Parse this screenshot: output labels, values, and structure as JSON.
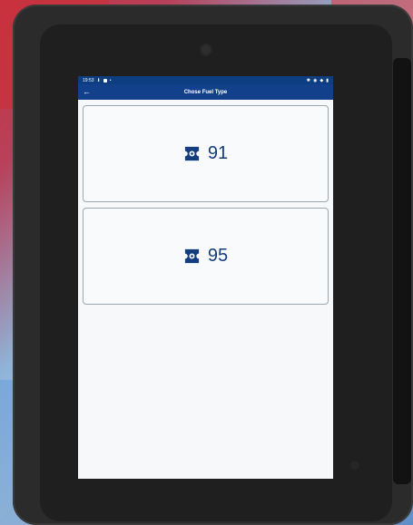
{
  "status_bar": {
    "time": "19:53"
  },
  "app_bar": {
    "title": "Chose Fuel Type"
  },
  "fuel_options": [
    {
      "label": "91",
      "icon": "fuel-ticket-icon"
    },
    {
      "label": "95",
      "icon": "fuel-ticket-icon"
    }
  ],
  "colors": {
    "app_bar": "#12408a",
    "accent_text": "#133d7c",
    "border": "#9aa6b2"
  }
}
